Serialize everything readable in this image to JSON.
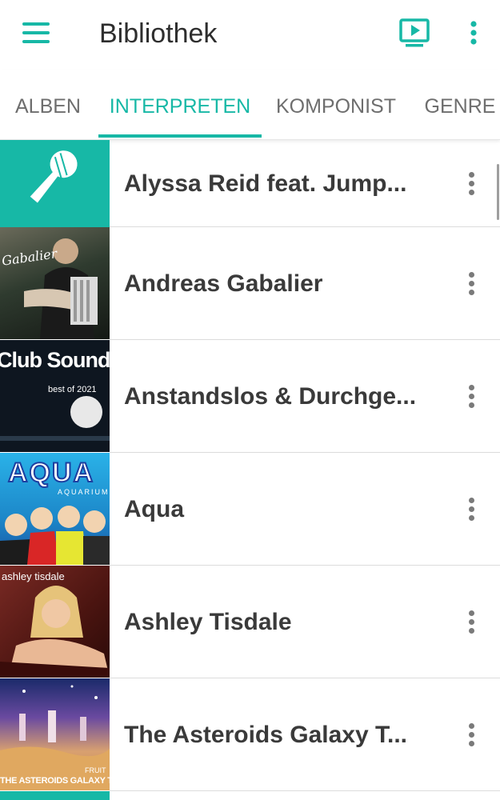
{
  "app": {
    "title": "Bibliothek",
    "accent_color": "#17b8a6",
    "icons": {
      "menu": "hamburger-menu-icon",
      "cast": "play-screen-icon",
      "overflow": "vertical-dots-icon"
    }
  },
  "tabs": [
    {
      "label": "ALBEN",
      "active": false
    },
    {
      "label": "INTERPRETEN",
      "active": true
    },
    {
      "label": "KOMPONIST",
      "active": false
    },
    {
      "label": "GENRE",
      "active": false
    }
  ],
  "artists": [
    {
      "name": "Alyssa Reid feat. Jump...",
      "thumb": "microphone-placeholder"
    },
    {
      "name": "Andreas Gabalier",
      "thumb": "album-cover",
      "cover_text": "Gabalier"
    },
    {
      "name": "Anstandslos & Durchge...",
      "thumb": "album-cover",
      "cover_text": "Club Sounds",
      "cover_subtext": "best of 2021"
    },
    {
      "name": "Aqua",
      "thumb": "album-cover",
      "cover_text": "AQUA",
      "cover_subtext": "AQUARIUM"
    },
    {
      "name": "Ashley Tisdale",
      "thumb": "album-cover",
      "cover_text": "ashley tisdale"
    },
    {
      "name": "The Asteroids Galaxy T...",
      "thumb": "album-cover",
      "cover_text": "THE ASTEROIDS GALAXY TOUR",
      "cover_subtext": "FRUIT"
    }
  ]
}
